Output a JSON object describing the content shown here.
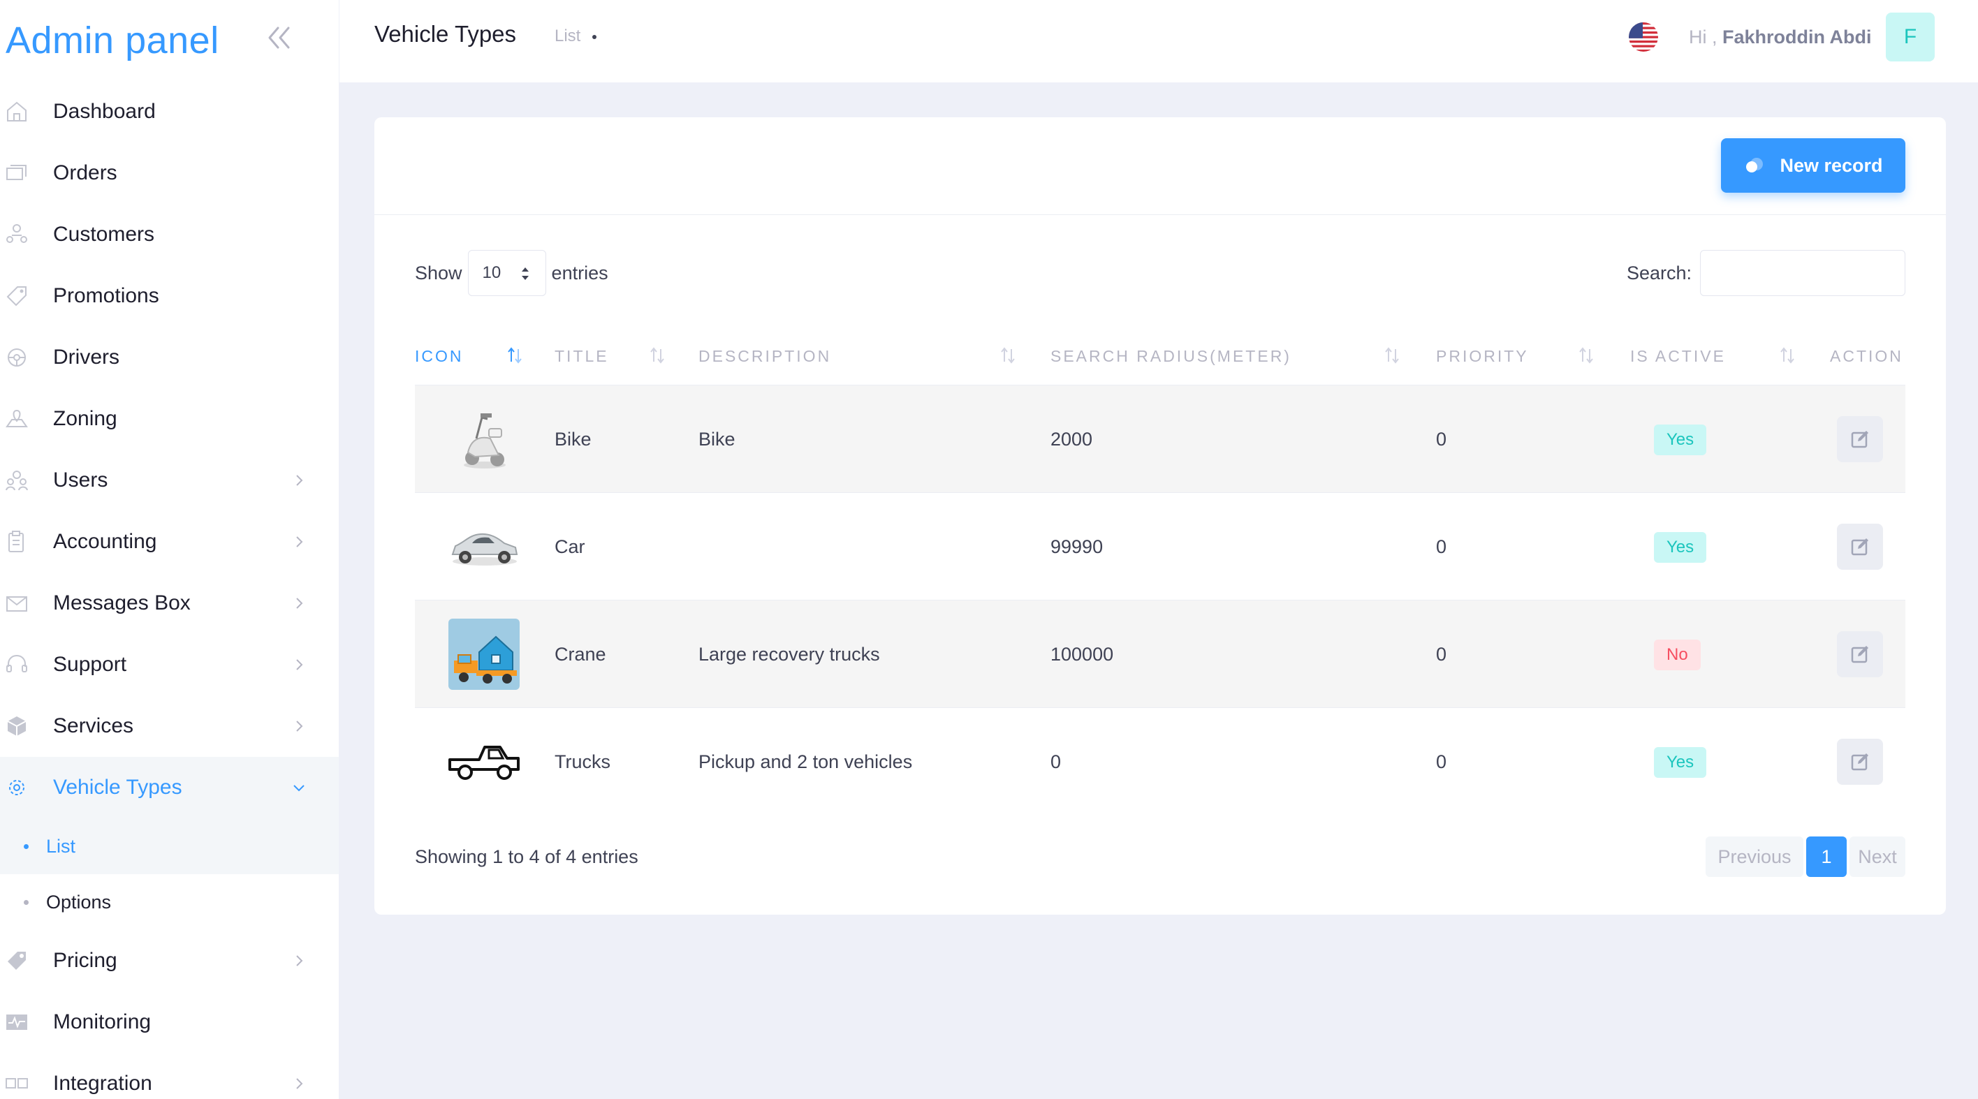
{
  "brand": {
    "title": "Admin panel"
  },
  "sidebar": {
    "items": [
      {
        "label": "Dashboard",
        "icon": "home-icon",
        "has_arrow": false
      },
      {
        "label": "Orders",
        "icon": "orders-icon",
        "has_arrow": false
      },
      {
        "label": "Customers",
        "icon": "customers-icon",
        "has_arrow": false
      },
      {
        "label": "Promotions",
        "icon": "tag-icon",
        "has_arrow": false
      },
      {
        "label": "Drivers",
        "icon": "drivers-icon",
        "has_arrow": false
      },
      {
        "label": "Zoning",
        "icon": "map-icon",
        "has_arrow": false
      },
      {
        "label": "Users",
        "icon": "users-icon",
        "has_arrow": true
      },
      {
        "label": "Accounting",
        "icon": "clipboard-icon",
        "has_arrow": true
      },
      {
        "label": "Messages Box",
        "icon": "envelope-icon",
        "has_arrow": true
      },
      {
        "label": "Support",
        "icon": "headset-icon",
        "has_arrow": true
      },
      {
        "label": "Services",
        "icon": "box-icon",
        "has_arrow": true
      },
      {
        "label": "Vehicle Types",
        "icon": "vehicle-icon",
        "has_arrow": true,
        "active": true
      },
      {
        "label": "Pricing",
        "icon": "price-tag-icon",
        "has_arrow": true
      },
      {
        "label": "Monitoring",
        "icon": "monitor-icon",
        "has_arrow": false
      },
      {
        "label": "Integration",
        "icon": "integration-icon",
        "has_arrow": true
      }
    ],
    "submenu": [
      {
        "label": "List",
        "active": true
      },
      {
        "label": "Options",
        "active": false
      }
    ]
  },
  "header": {
    "title": "Vehicle Types",
    "breadcrumb": "List",
    "greeting": "Hi ,",
    "user_name": "Fakhroddin Abdi",
    "avatar_letter": "F",
    "flag_icon": "us-flag-icon"
  },
  "toolbar": {
    "new_record_label": "New record"
  },
  "table_controls": {
    "show_label": "Show",
    "entries_label": "entries",
    "page_length": "10",
    "search_label": "Search:",
    "search_value": ""
  },
  "table": {
    "columns": [
      "ICON",
      "TITLE",
      "DESCRIPTION",
      "SEARCH RADIUS(METER)",
      "PRIORITY",
      "IS ACTIVE",
      "ACTION"
    ],
    "rows": [
      {
        "icon": "bike-image",
        "title": "Bike",
        "description": "Bike",
        "search_radius": "2000",
        "priority": "0",
        "is_active": "Yes"
      },
      {
        "icon": "car-image",
        "title": "Car",
        "description": "",
        "search_radius": "99990",
        "priority": "0",
        "is_active": "Yes"
      },
      {
        "icon": "crane-image",
        "title": "Crane",
        "description": "Large recovery trucks",
        "search_radius": "100000",
        "priority": "0",
        "is_active": "No"
      },
      {
        "icon": "truck-image",
        "title": "Trucks",
        "description": "Pickup and 2 ton vehicles",
        "search_radius": "0",
        "priority": "0",
        "is_active": "Yes"
      }
    ]
  },
  "footer": {
    "info": "Showing 1 to 4 of 4 entries",
    "previous": "Previous",
    "current_page": "1",
    "next": "Next"
  },
  "colors": {
    "primary": "#3699ff",
    "success_bg": "#c9f7f5",
    "success_text": "#1bc5bd",
    "danger_bg": "#ffe2e5",
    "danger_text": "#f64e60",
    "page_bg": "#eef0f8"
  }
}
